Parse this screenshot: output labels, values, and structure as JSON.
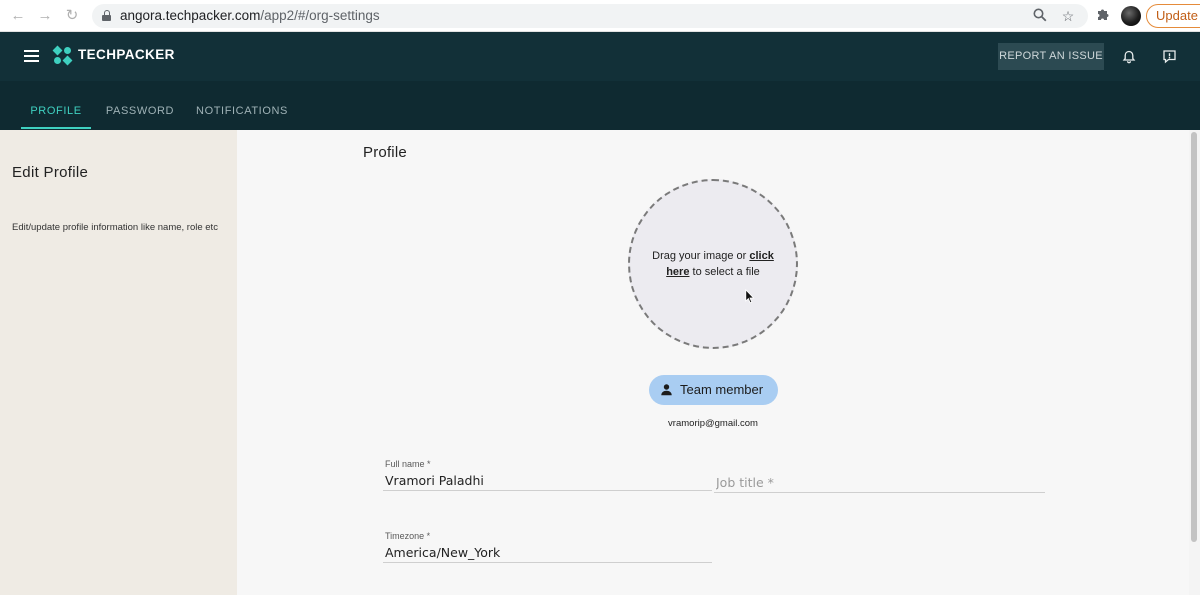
{
  "browser": {
    "url_host": "angora.techpacker.com",
    "url_path": "/app2/#/org-settings",
    "update_label": "Update"
  },
  "header": {
    "brand": "TECHPACKER",
    "report_label": "REPORT AN ISSUE"
  },
  "tabs": [
    {
      "label": "PROFILE",
      "active": true
    },
    {
      "label": "PASSWORD",
      "active": false
    },
    {
      "label": "NOTIFICATIONS",
      "active": false
    }
  ],
  "sidebar": {
    "title": "Edit Profile",
    "description": "Edit/update profile information like name, role etc"
  },
  "main": {
    "section_title": "Profile",
    "dropzone": {
      "text_before": "Drag your image or ",
      "link_part1": "click",
      "link_part2": "here",
      "text_after": " to select a file"
    },
    "role": "Team member",
    "email": "vramorip@gmail.com",
    "fields": {
      "full_name": {
        "label": "Full name *",
        "value": "Vramori Paladhi"
      },
      "job_title": {
        "placeholder": "Job title *"
      },
      "timezone": {
        "label": "Timezone *",
        "value": "America/New_York"
      }
    }
  },
  "colors": {
    "header_bg": "#123038",
    "tab_bar_bg": "#0f2a31",
    "accent": "#3fd0c0",
    "sidebar_bg": "#efebe4",
    "role_chip_bg": "#a9cdf2"
  }
}
